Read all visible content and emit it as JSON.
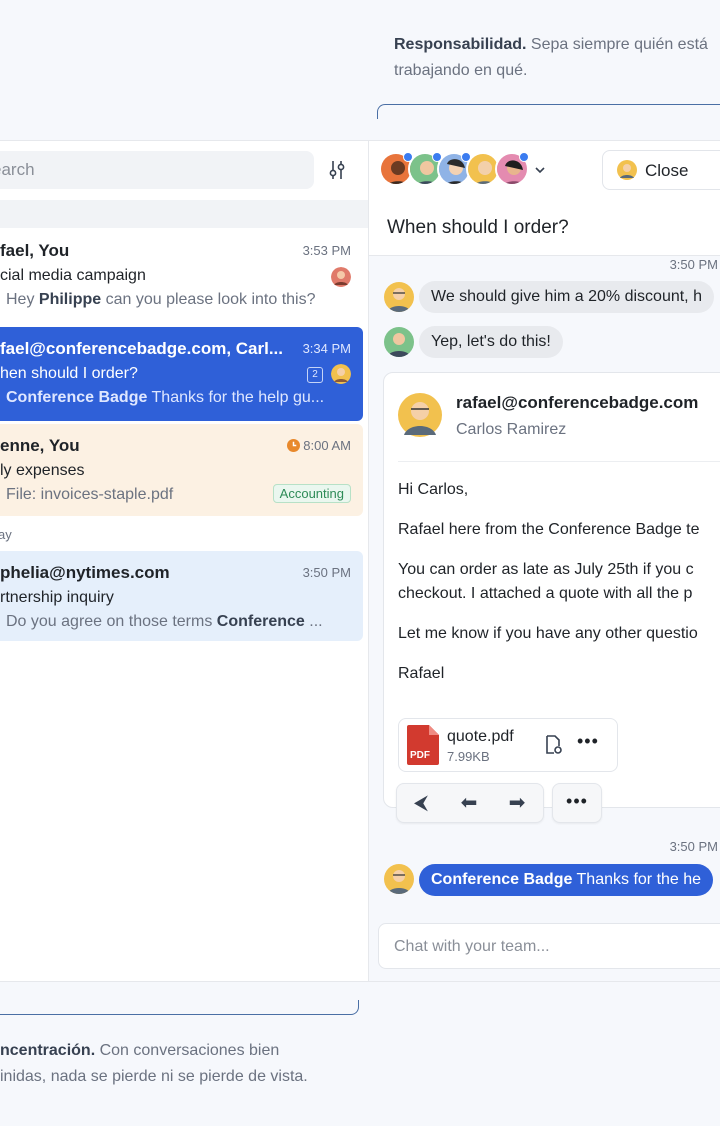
{
  "marketing": {
    "top_bold": "Responsabilidad.",
    "top_rest": "Sepa siempre quién está trabajando en qué.",
    "bottom_bold": "ncentración.",
    "bottom_rest": "Con conversaciones bien",
    "bottom_line2": "inidas, nada se pierde ni se pierde de vista."
  },
  "left": {
    "search_placeholder": "earch",
    "day_label": "ay",
    "conversations": [
      {
        "names": "fael, You",
        "time": "3:53 PM",
        "subject": "cial media campaign",
        "preview_pre": "Hey ",
        "preview_bold": "Philippe",
        "preview_post": " can you please look into this?"
      },
      {
        "names": "fael@conferencebadge.com, Carl...",
        "time": "3:34 PM",
        "subject": "hen should I order?",
        "count": "2",
        "preview_bold": "Conference Badge",
        "preview_post": " Thanks for the help gu..."
      },
      {
        "names": "enne, You",
        "time": "8:00 AM",
        "subject": "ly expenses",
        "preview_post": "File: invoices-staple.pdf",
        "tag": "Accounting"
      },
      {
        "names": "phelia@nytimes.com",
        "time": "3:50 PM",
        "subject": "rtnership inquiry",
        "preview_pre": "Do you agree on those terms ",
        "preview_bold": "Conference",
        "preview_post": " ..."
      }
    ]
  },
  "right": {
    "close_label": "Close",
    "subject": "When should I order?",
    "ts1": "3:50 PM",
    "msg1": "We should give him a 20% discount, h",
    "msg2": "Yep, let's do this!",
    "email": {
      "from": "rafael@conferencebadge.com",
      "to": "Carlos Ramirez",
      "greeting": "Hi Carlos,",
      "p1": "Rafael here from the Conference Badge te",
      "p2a": "You can order as late as July 25th if you c",
      "p2b": "checkout. I attached a quote with all the p",
      "p3": "Let me know if you have any other questio",
      "sign": "Rafael",
      "attachment_name": "quote.pdf",
      "attachment_size": "7.99KB",
      "pdf_label": "PDF"
    },
    "ts2": "3:50 PM",
    "msg3_bold": "Conference Badge",
    "msg3_rest": " Thanks for the he",
    "chat_placeholder": "Chat with your team..."
  },
  "colors": {
    "accent": "#2f60d8",
    "selected_row": "#2f60d8",
    "pending_row": "#fcf1e3",
    "unread_row": "#e5effb",
    "tag_green": "#2e8b57",
    "clock_orange": "#e8892c"
  }
}
